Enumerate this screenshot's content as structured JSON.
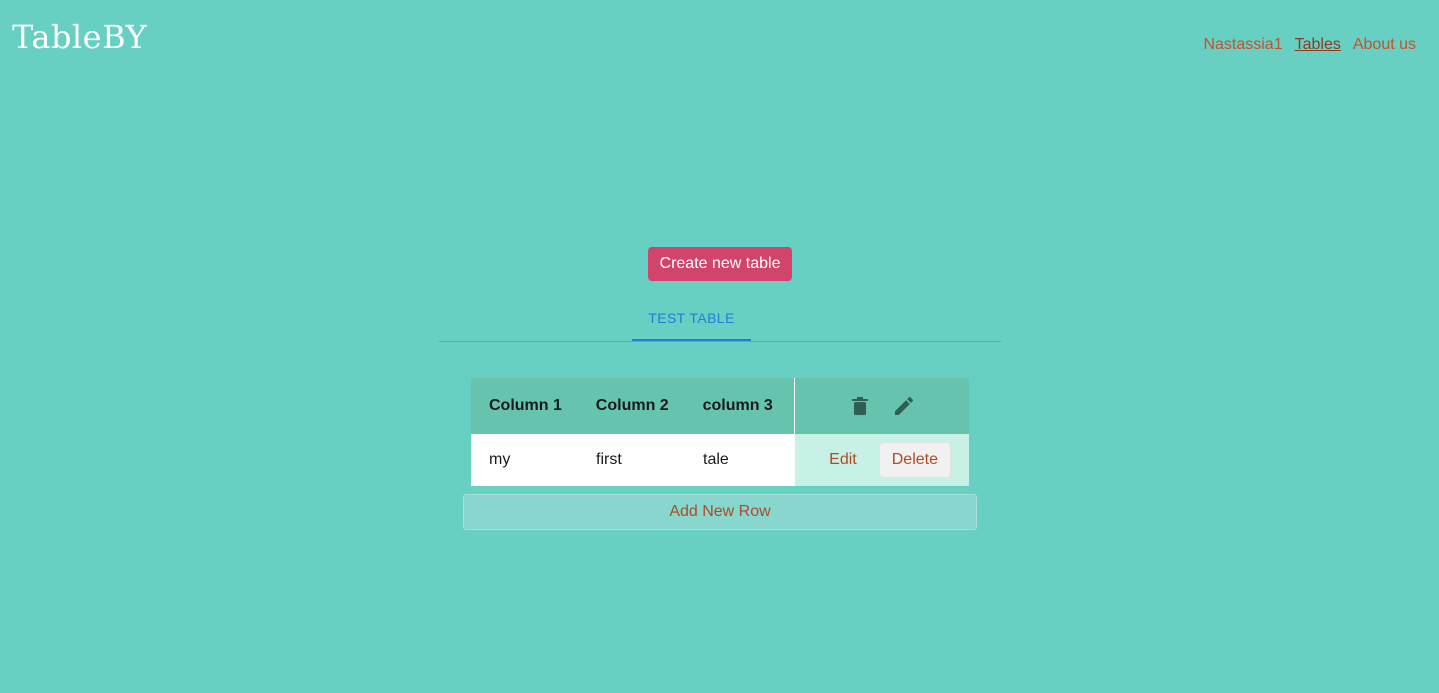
{
  "header": {
    "logo": "TableBY",
    "nav": [
      {
        "label": "Nastassia1"
      },
      {
        "label": "Tables"
      },
      {
        "label": "About us"
      }
    ]
  },
  "main": {
    "create_button": "Create new table",
    "tabs": [
      {
        "label": "TEST TABLE"
      }
    ],
    "table": {
      "columns": [
        "Column 1",
        "Column 2",
        "column 3"
      ],
      "rows": [
        [
          "my",
          "first",
          "tale"
        ]
      ],
      "header_icons": [
        "trash-icon",
        "pencil-icon"
      ],
      "row_actions": {
        "edit": "Edit",
        "delete": "Delete"
      }
    },
    "add_row_button": "Add New Row"
  },
  "colors": {
    "background": "#67d0c3",
    "accent_button": "#d1456c",
    "tab_active": "#1f7fd6",
    "link": "#c8502c"
  }
}
